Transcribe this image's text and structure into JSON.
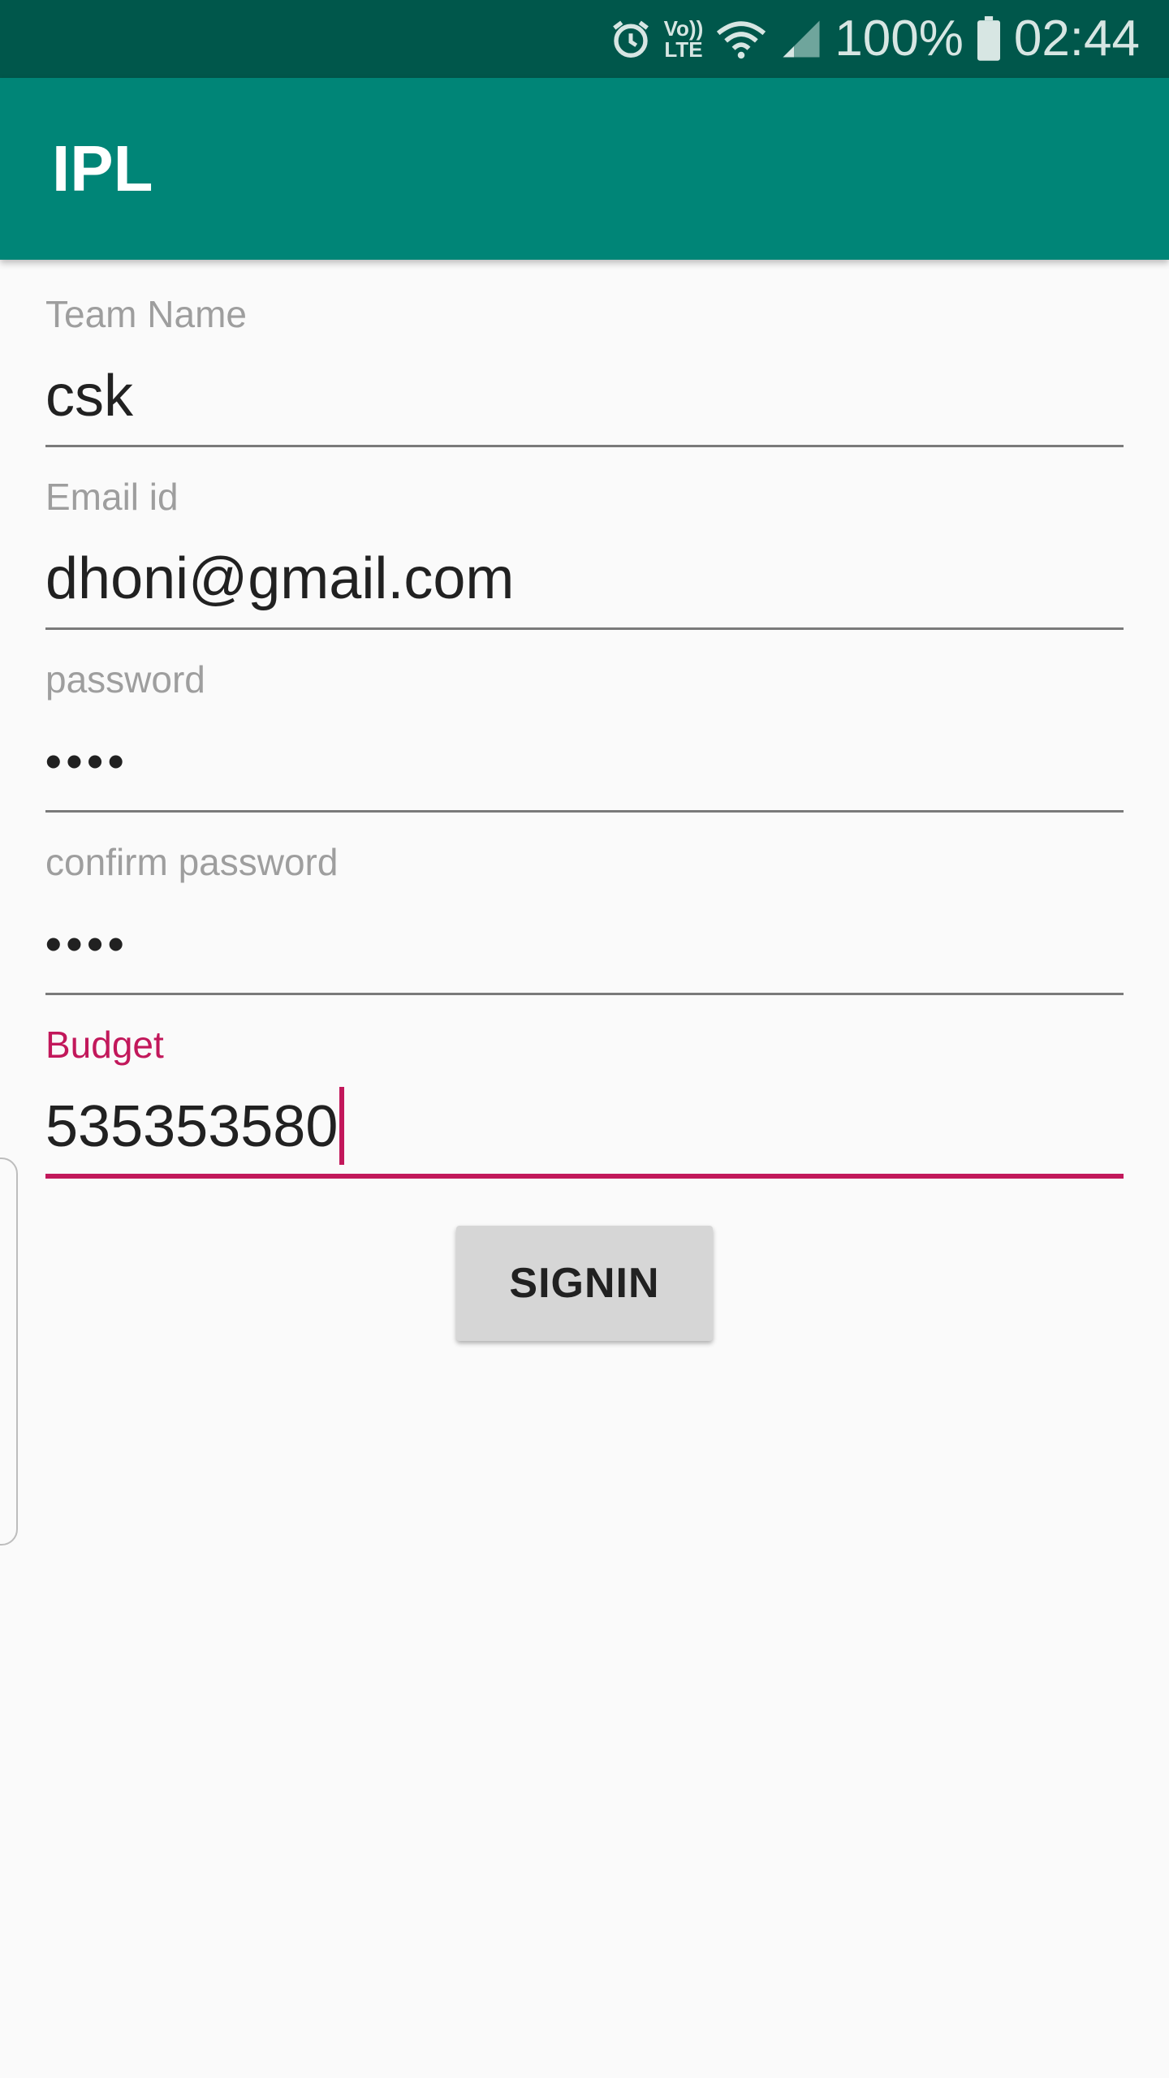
{
  "status_bar": {
    "icons": [
      "alarm-icon",
      "volte-icon",
      "wifi-icon",
      "signal-icon",
      "battery-icon"
    ],
    "volte_top": "Vo))",
    "volte_bottom": "LTE",
    "battery_percent": "100%",
    "time": "02:44"
  },
  "app_bar": {
    "title": "IPL",
    "color": "#008577"
  },
  "form": {
    "team_name": {
      "label": "Team Name",
      "value": "csk"
    },
    "email": {
      "label": "Email id",
      "value": "dhoni@gmail.com"
    },
    "password": {
      "label": "password",
      "value": "••••"
    },
    "confirm_password": {
      "label": "confirm password",
      "value": "••••"
    },
    "budget": {
      "label": "Budget",
      "value": "535353580"
    },
    "accent_color": "#c2185b"
  },
  "signin_button": {
    "label": "SIGNIN"
  }
}
